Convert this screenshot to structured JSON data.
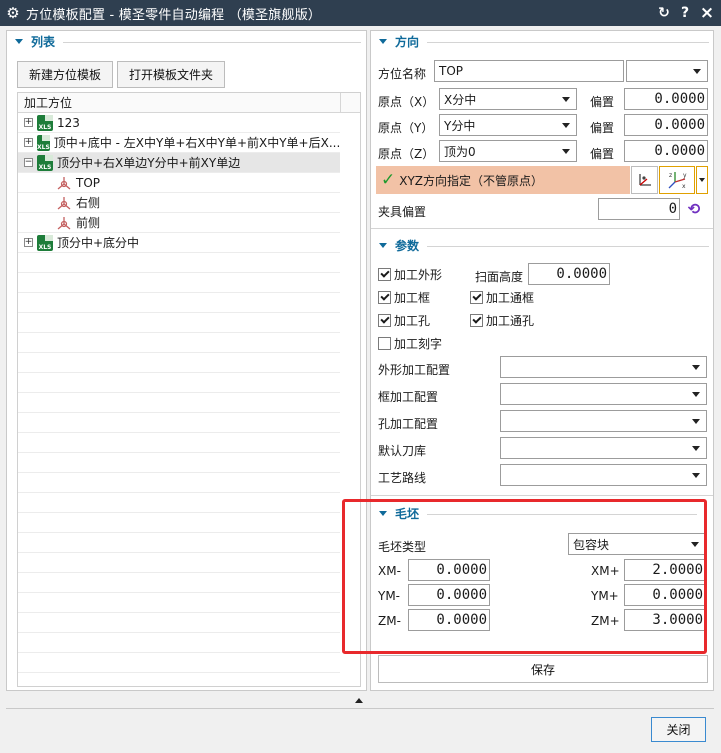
{
  "window": {
    "title": "方位模板配置 - 模圣零件自动编程 （模圣旗舰版）",
    "gear_icon": "gear-icon",
    "reset_icon": "reset-icon",
    "help_label": "?",
    "close_label": "×"
  },
  "list": {
    "title": "列表",
    "new_button": "新建方位模板",
    "open_button": "打开模板文件夹",
    "column_header": "加工方位",
    "rows": [
      {
        "text": "123",
        "expander": "+"
      },
      {
        "text": "顶中+底中 - 左X中Y单+右X中Y单+前X中Y单+后X...",
        "expander": "+"
      },
      {
        "text": "顶分中+右X单边Y分中+前XY单边",
        "expander": "−"
      },
      {
        "text": "TOP"
      },
      {
        "text": "右侧"
      },
      {
        "text": "前侧"
      },
      {
        "text": "顶分中+底分中",
        "expander": "+"
      }
    ]
  },
  "direction": {
    "title": "方向",
    "name_label": "方位名称",
    "name_value": "TOP",
    "origin_x_label": "原点（X）",
    "origin_x_value": "X分中",
    "origin_y_label": "原点（Y）",
    "origin_y_value": "Y分中",
    "origin_z_label": "原点（Z）",
    "origin_z_value": "顶为0",
    "offset_label": "偏置",
    "offset_x": "0.0000",
    "offset_y": "0.0000",
    "offset_z": "0.0000",
    "xyz_label": "XYZ方向指定（不管原点）",
    "fixture_label": "夹具偏置",
    "fixture_value": "0"
  },
  "params": {
    "title": "参数",
    "outer_label": "加工外形",
    "scan_height_label": "扫面高度",
    "scan_height_value": "0.0000",
    "frame_label": "加工框",
    "through_frame_label": "加工通框",
    "hole_label": "加工孔",
    "through_hole_label": "加工通孔",
    "engrave_label": "加工刻字",
    "outer_config_label": "外形加工配置",
    "frame_config_label": "框加工配置",
    "hole_config_label": "孔加工配置",
    "tool_lib_label": "默认刀库",
    "route_label": "工艺路线"
  },
  "blank": {
    "title": "毛坯",
    "type_label": "毛坯类型",
    "type_value": "包容块",
    "xm_label": "XM-",
    "xm_value": "0.0000",
    "ym_label": "YM-",
    "ym_value": "0.0000",
    "zm_label": "ZM-",
    "zm_value": "0.0000",
    "xp_label": "XM+",
    "xp_value": "2.0000",
    "yp_label": "YM+",
    "yp_value": "0.0000",
    "zp_label": "ZM+",
    "zp_value": "3.0000"
  },
  "save_button": "保存",
  "close_button": "关闭",
  "colors": {
    "titlebar": "#2f3f50",
    "accent": "#0f6a9a",
    "xyz_bar": "#f2c2a6",
    "highlight": "#e8292c"
  }
}
